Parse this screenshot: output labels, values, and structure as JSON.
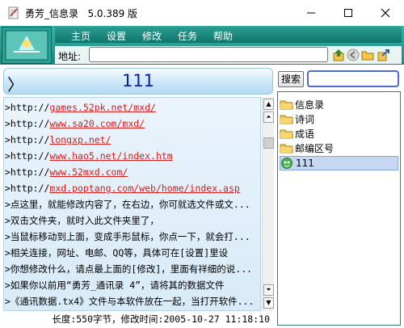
{
  "window": {
    "title": "勇芳_信息录   5.0.389 版"
  },
  "menu": {
    "items": [
      "主页",
      "设置",
      "修改",
      "任务",
      "帮助"
    ]
  },
  "address": {
    "label": "地址:",
    "value": ""
  },
  "topic": {
    "arrow": "〉",
    "title": "111"
  },
  "content": {
    "lines": [
      {
        "prefix": ">http://",
        "link": "games.52pk.net/mxd/",
        "text": ""
      },
      {
        "prefix": ">http://",
        "link": "www.sa20.com/mxd/",
        "text": ""
      },
      {
        "prefix": ">http://",
        "link": "longxp.net/",
        "text": ""
      },
      {
        "prefix": ">http://",
        "link": "www.hao5.net/index.htm",
        "text": ""
      },
      {
        "prefix": ">http://",
        "link": "www.52mxd.com/",
        "text": ""
      },
      {
        "prefix": ">http://",
        "link": "mxd.poptang.com/web/home/index.asp",
        "text": ""
      },
      {
        "prefix": "",
        "link": "",
        "text": ">点这里，就能修改内容了，在右边，你可就选文件或文..."
      },
      {
        "prefix": "",
        "link": "",
        "text": ">双击文件夹，就时入此文件夹里了，"
      },
      {
        "prefix": "",
        "link": "",
        "text": ">当鼠标移动到上面，变成手形鼠标，你点一下，就会打..."
      },
      {
        "prefix": "",
        "link": "",
        "text": ">相关连接，网址、电邮、QQ等，具体可在[设置]里设"
      },
      {
        "prefix": "",
        "link": "",
        "text": ">你想修改什么，请点最上面的[修改]，里面有祥细的说..."
      },
      {
        "prefix": "",
        "link": "",
        "text": ">如果你以前用“勇芳_通讯录 4”，请将其的数据文件"
      },
      {
        "prefix": "",
        "link": "",
        "text": ">《通讯数据.tx4》文件与本软件放在一起，当打开软件..."
      }
    ]
  },
  "status": {
    "text": "长度:550字节，修改时间:2005-10-27 11:18:10"
  },
  "search": {
    "button_label": "搜索",
    "value": ""
  },
  "tree": {
    "items": [
      {
        "label": "信息录",
        "icon": "folder-icon",
        "selected": false
      },
      {
        "label": "诗词",
        "icon": "folder-icon",
        "selected": false
      },
      {
        "label": "成语",
        "icon": "folder-icon",
        "selected": false
      },
      {
        "label": "邮编区号",
        "icon": "folder-icon",
        "selected": false
      },
      {
        "label": "111",
        "icon": "document-icon",
        "selected": true
      }
    ]
  },
  "colors": {
    "header": "#1f9c90",
    "link": "#d91b1b",
    "topic_title": "#0a1fa0",
    "selection": "#c6d7f1"
  }
}
